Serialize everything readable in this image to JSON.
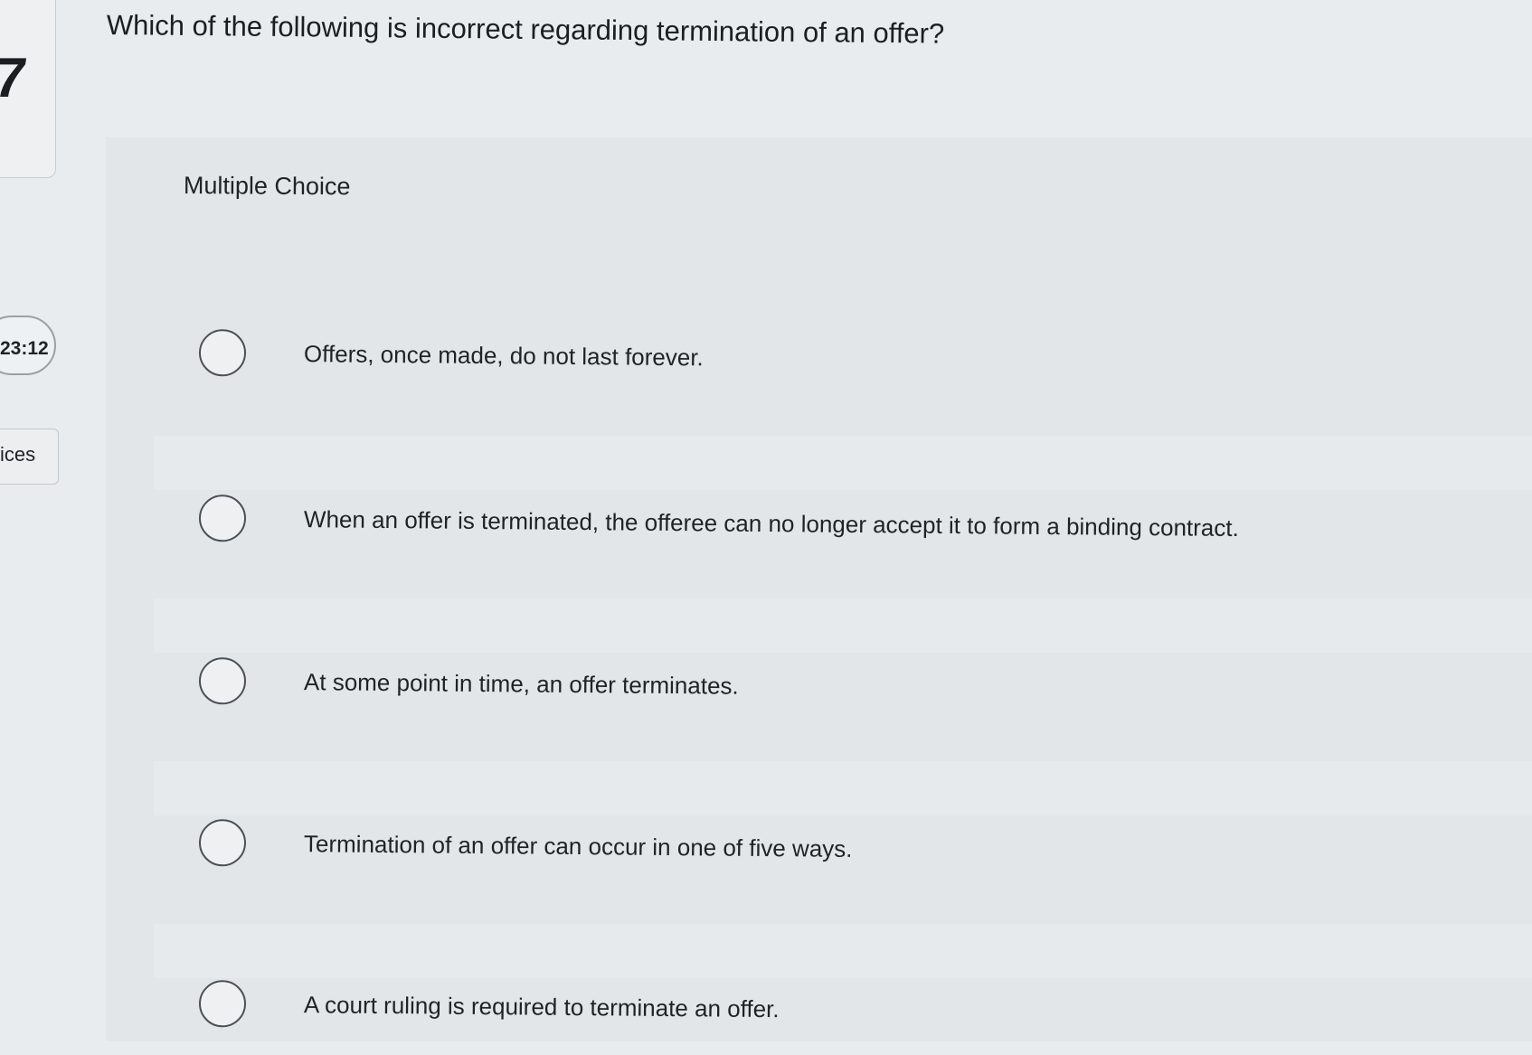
{
  "sidebar": {
    "question_number": "7",
    "timer": "23:12",
    "tab_label": "ices"
  },
  "question": {
    "text": "Which of the following is incorrect regarding termination of an offer?",
    "type_label": "Multiple Choice",
    "choices": [
      "Offers, once made, do not last forever.",
      "When an offer is terminated, the offeree can no longer accept it to form a binding contract.",
      "At some point in time, an offer terminates.",
      "Termination of an offer can occur in one of five ways.",
      "A court ruling is required to terminate an offer."
    ]
  }
}
